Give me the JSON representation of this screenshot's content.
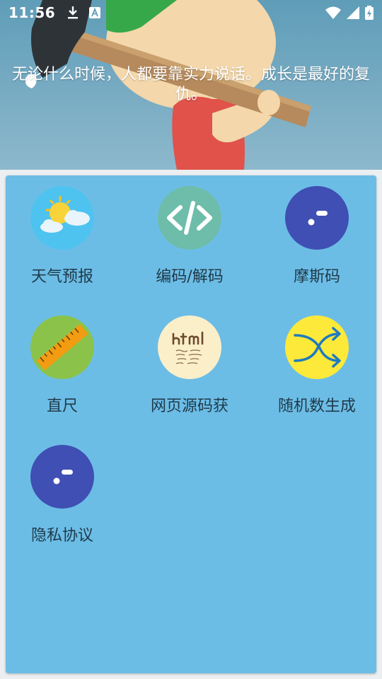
{
  "status_bar": {
    "time": "11:56",
    "icons": [
      "download-icon",
      "a-notification-icon",
      "wifi-icon",
      "signal-icon",
      "battery-charging-icon"
    ]
  },
  "banner": {
    "quote": "无论什么时候，人都要靠实力说话。成长是最好的复仇。"
  },
  "tools": [
    {
      "label": "天气预报",
      "icon": "weather-icon"
    },
    {
      "label": "编码/解码",
      "icon": "code-icon"
    },
    {
      "label": "摩斯码",
      "icon": "morse-icon"
    },
    {
      "label": "直尺",
      "icon": "ruler-icon"
    },
    {
      "label": "网页源码获",
      "icon": "html-icon"
    },
    {
      "label": "随机数生成",
      "icon": "shuffle-icon"
    },
    {
      "label": "隐私协议",
      "icon": "privacy-icon"
    }
  ],
  "colors": {
    "banner_bg": "#6aa3bd",
    "card_bg": "#6cbde6",
    "label_text": "#1f3a4a"
  }
}
